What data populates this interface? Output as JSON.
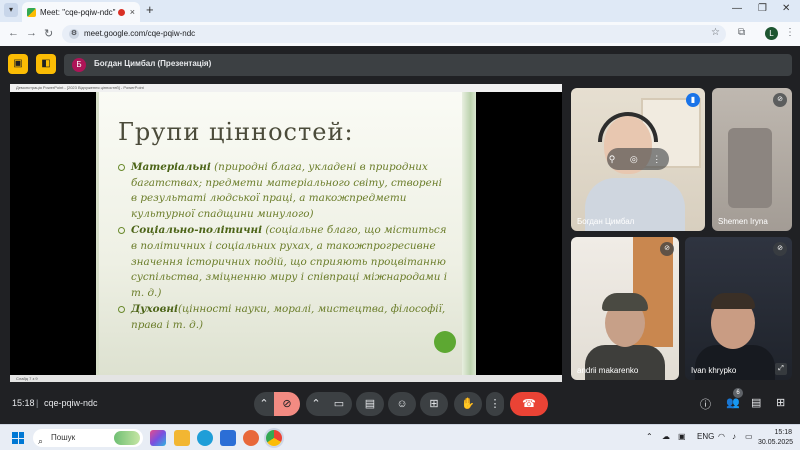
{
  "browser": {
    "tab_title": "Meet: \"cqe-pqiw-ndc\"",
    "tab_close": "×",
    "new_tab": "+",
    "url": "meet.google.com/cqe-pqiw-ndc",
    "profile_initial": "L",
    "win_controls": [
      "—",
      "❐",
      "✕"
    ]
  },
  "meet": {
    "presenter_initial": "Б",
    "presenter_label": "Богдан Цимбал (Презентація)",
    "ppt_title": "Демонстрація PowerPoint - [2023 Відчуження цінностей] - PowerPoint",
    "ppt_status": "Слайд 7 з 9",
    "slide": {
      "title": "Групи цінностей:",
      "bullets": [
        {
          "head": "Матеріальні",
          "text": " (природні блага, укладені в природних багатствах; предмети матеріального світу, створені в результаті людської праці, а такожпредмети культурної спадщини минулого)"
        },
        {
          "head": "Соціально-політичні",
          "text": " (соціальне благо, що міститься в політичних і соціальних рухах, а такожпрогресивне значення історичних подій, що сприяють процвітанню суспільства, зміцненню миру і співпраці міжнародами і т. д.)"
        },
        {
          "head": "Духовні",
          "text": "(цінності науки, моралі, мистецтва, філософії, права і т. д.)"
        }
      ]
    },
    "participants": [
      {
        "name": "Богдан Цимбал"
      },
      {
        "name": "Shemen Iryna"
      },
      {
        "name": "andrii makarenko"
      },
      {
        "name": "Ivan khrypko"
      }
    ],
    "time": "15:18",
    "separator": "|",
    "meeting_code": "cqe-pqiw-ndc",
    "people_count": "6"
  },
  "taskbar": {
    "search_placeholder": "Пошук",
    "lang": "ENG",
    "clock_time": "15:18",
    "clock_date": "30.05.2025"
  },
  "colors": {
    "accent": "#fbbc04",
    "hangup": "#ea4335",
    "slide_text": "#6b7d2a"
  }
}
